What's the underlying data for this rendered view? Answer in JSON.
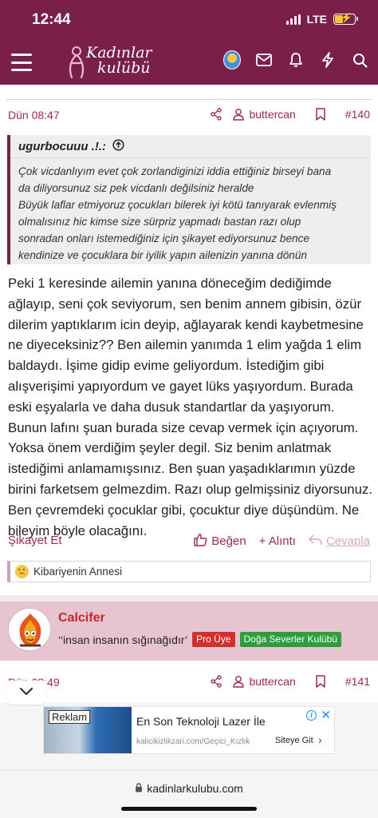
{
  "status_bar": {
    "time": "12:44",
    "network": "LTE"
  },
  "site": {
    "logo_line1": "Kadınlar",
    "logo_line2": "kulübü",
    "brand_color": "#7a1f4a"
  },
  "post1": {
    "date": "Dün 08:47",
    "author": "buttercan",
    "number": "#140",
    "quote": {
      "author": "ugurbocuuu .!.:",
      "lines": [
        "Çok vicdanlıyım evet çok zorlandiginizi iddia ettiğiniz birseyi bana",
        "da diliyorsunuz siz pek vicdanlı değilsiniz heralde",
        "Büyük laflar etmiyoruz çocukları bilerek iyi kötü tanıyarak evlenmiş",
        "olmalısınız hic kimse size sürpriz yapmadı bastan razı olup",
        "sonradan onları istemediğiniz için şikayet ediyorsunuz bence",
        "kendinize ve çocuklara bir iyilik yapın ailenizin yanına dönün"
      ]
    },
    "body": "Peki 1 keresinde ailemin yanına döneceğim dediğimde ağlayıp, seni çok seviyorum, sen benim annem gibisin, özür dilerim yaptıklarım icin deyip, ağlayarak kendi kaybetmesine ne diyeceksiniz?? Ben ailemin yanımda 1 elim yağda 1 elim baldaydı. İşime gidip evime geliyordum. İstediğim gibi alışverişimi yapıyordum ve gayet lüks yaşıyordum. Burada eski eşyalarla ve daha dusuk standartlar da yaşıyorum. Bunun lafını şuan burada size cevap vermek için açıyorum. Yoksa önem verdiğim şeyler degil. Siz benim anlatmak istediğimi anlamamışsınız. Ben şuan yaşadıklarımın yüzde birini farketsem gelmezdim. Razı olup gelmişsiniz diyorsunuz. Ben çevremdeki çocuklar gibi, çocuktur diye düşündüm. Ne bileyim böyle olacağını.",
    "actions": {
      "report": "Şikayet Et",
      "like": "Beğen",
      "quote": "+ Alıntı",
      "reply": "Cevapla"
    },
    "reaction": "Kibariyenin Annesi"
  },
  "author_card": {
    "name": "Calcifer",
    "title": "‘‘insan insanın sığınağıdır’",
    "badges": [
      "Pro Üye",
      "Doğa Severler Kulübü"
    ]
  },
  "post2": {
    "date": "Dün 08:49",
    "author": "buttercan",
    "number": "#141"
  },
  "ad": {
    "label": "Reklam",
    "title": "En Son Teknoloji Lazer İle",
    "url": "kalicikizlikzari.com/Geçici_Kızlık",
    "cta": "Siteye Git"
  },
  "browser": {
    "url": "kadinlarkulubu.com"
  },
  "colors": {
    "accent": "#a0294f",
    "author_card_bg": "#e6c5d0",
    "pro_badge": "#d32f2f",
    "club_badge": "#2e9d3e"
  },
  "icons": [
    "hamburger-icon",
    "avatar",
    "mail-icon",
    "bell-icon",
    "lightning-icon",
    "search-icon",
    "share-icon",
    "user-icon",
    "bookmark-icon",
    "quote-collapse-icon",
    "thumbs-up-icon",
    "reply-icon",
    "chevron-down-icon",
    "lock-icon"
  ]
}
